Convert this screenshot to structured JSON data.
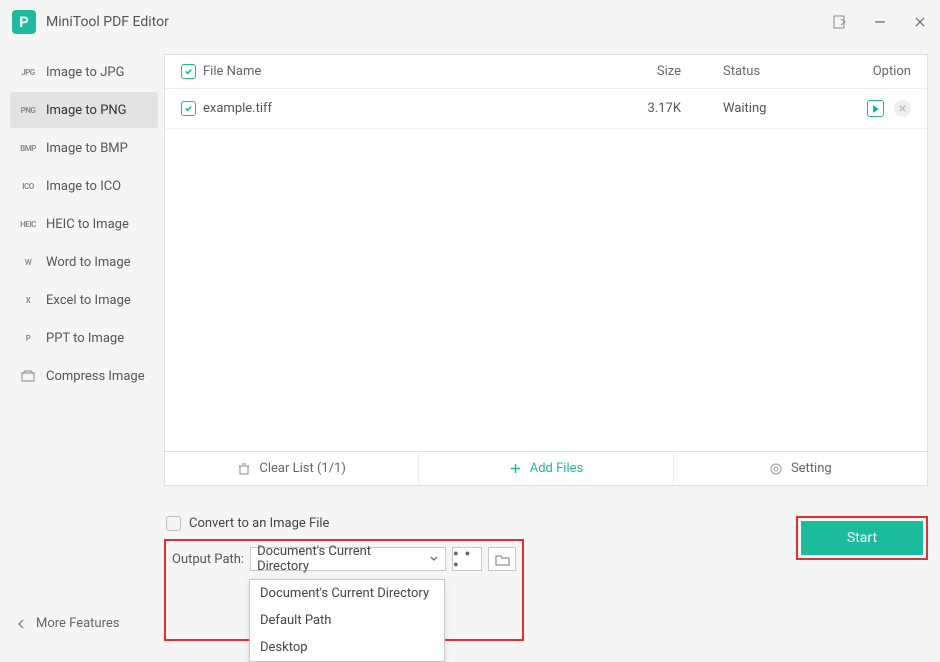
{
  "app": {
    "title": "MiniTool PDF Editor"
  },
  "sidebar": {
    "items": [
      {
        "badge": "JPG",
        "label": "Image to JPG"
      },
      {
        "badge": "PNG",
        "label": "Image to PNG"
      },
      {
        "badge": "BMP",
        "label": "Image to BMP"
      },
      {
        "badge": "ICO",
        "label": "Image to ICO"
      },
      {
        "badge": "HEIC",
        "label": "HEIC to Image"
      },
      {
        "badge": "W",
        "label": "Word to Image"
      },
      {
        "badge": "X",
        "label": "Excel to Image"
      },
      {
        "badge": "P",
        "label": "PPT to Image"
      },
      {
        "badge": "",
        "label": "Compress Image"
      }
    ],
    "activeIndex": 1,
    "moreFeatures": "More Features"
  },
  "table": {
    "headers": {
      "file": "File Name",
      "size": "Size",
      "status": "Status",
      "option": "Option"
    },
    "rows": [
      {
        "name": "example.tiff",
        "size": "3.17K",
        "status": "Waiting"
      }
    ]
  },
  "footer": {
    "clear": "Clear List (1/1)",
    "add": "Add Files",
    "setting": "Setting"
  },
  "options": {
    "convertLabel": "Convert to an Image File",
    "outputLabel": "Output Path:",
    "outputSelected": "Document's Current Directory",
    "dropdown": [
      "Document's Current Directory",
      "Default Path",
      "Desktop"
    ]
  },
  "start": "Start"
}
